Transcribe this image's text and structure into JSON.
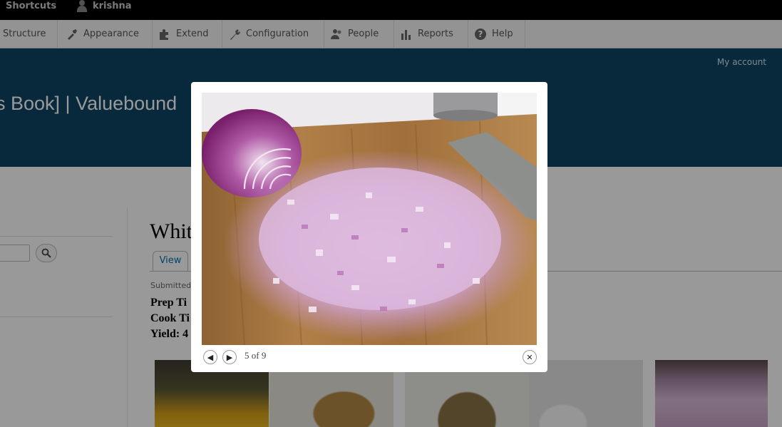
{
  "toolbar": {
    "shortcuts": "Shortcuts",
    "user": "krishna"
  },
  "admin_menu": {
    "items": [
      {
        "label": "Structure",
        "icon": "structure-icon"
      },
      {
        "label": "Appearance",
        "icon": "paintbrush-icon"
      },
      {
        "label": "Extend",
        "icon": "puzzle-icon"
      },
      {
        "label": "Configuration",
        "icon": "wrench-icon"
      },
      {
        "label": "People",
        "icon": "people-icon"
      },
      {
        "label": "Reports",
        "icon": "bar-chart-icon"
      },
      {
        "label": "Help",
        "icon": "help-icon"
      }
    ]
  },
  "header": {
    "site_title": "s Book] | Valuebound",
    "my_account": "My account",
    "background": "#0c4563"
  },
  "page": {
    "title": "Whit",
    "tab_view": "View",
    "submitted": "Submitted",
    "prep_time": "Prep Ti",
    "cook_time": "Cook Ti",
    "yield": "Yield: 4"
  },
  "lightbox": {
    "counter": "5 of 9",
    "prev_icon": "arrow-left-icon",
    "next_icon": "arrow-right-icon",
    "close_icon": "close-icon"
  }
}
